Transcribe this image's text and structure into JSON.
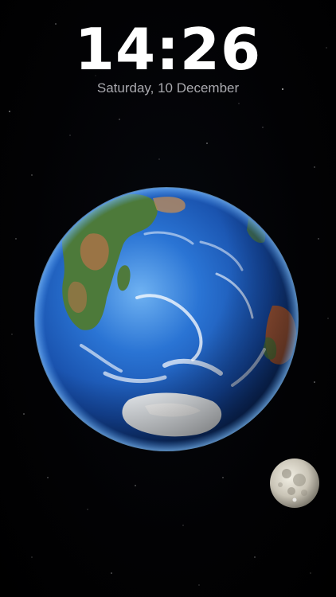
{
  "lock_screen": {
    "time": "14:26",
    "date": "Saturday, 10 December"
  },
  "wallpaper": {
    "subject": "earth-and-moon",
    "colors": {
      "ocean": "#1e63c6",
      "land": "#4d7a3a",
      "desert": "#b4734a",
      "ice": "#eef2f6",
      "space": "#000000"
    }
  }
}
